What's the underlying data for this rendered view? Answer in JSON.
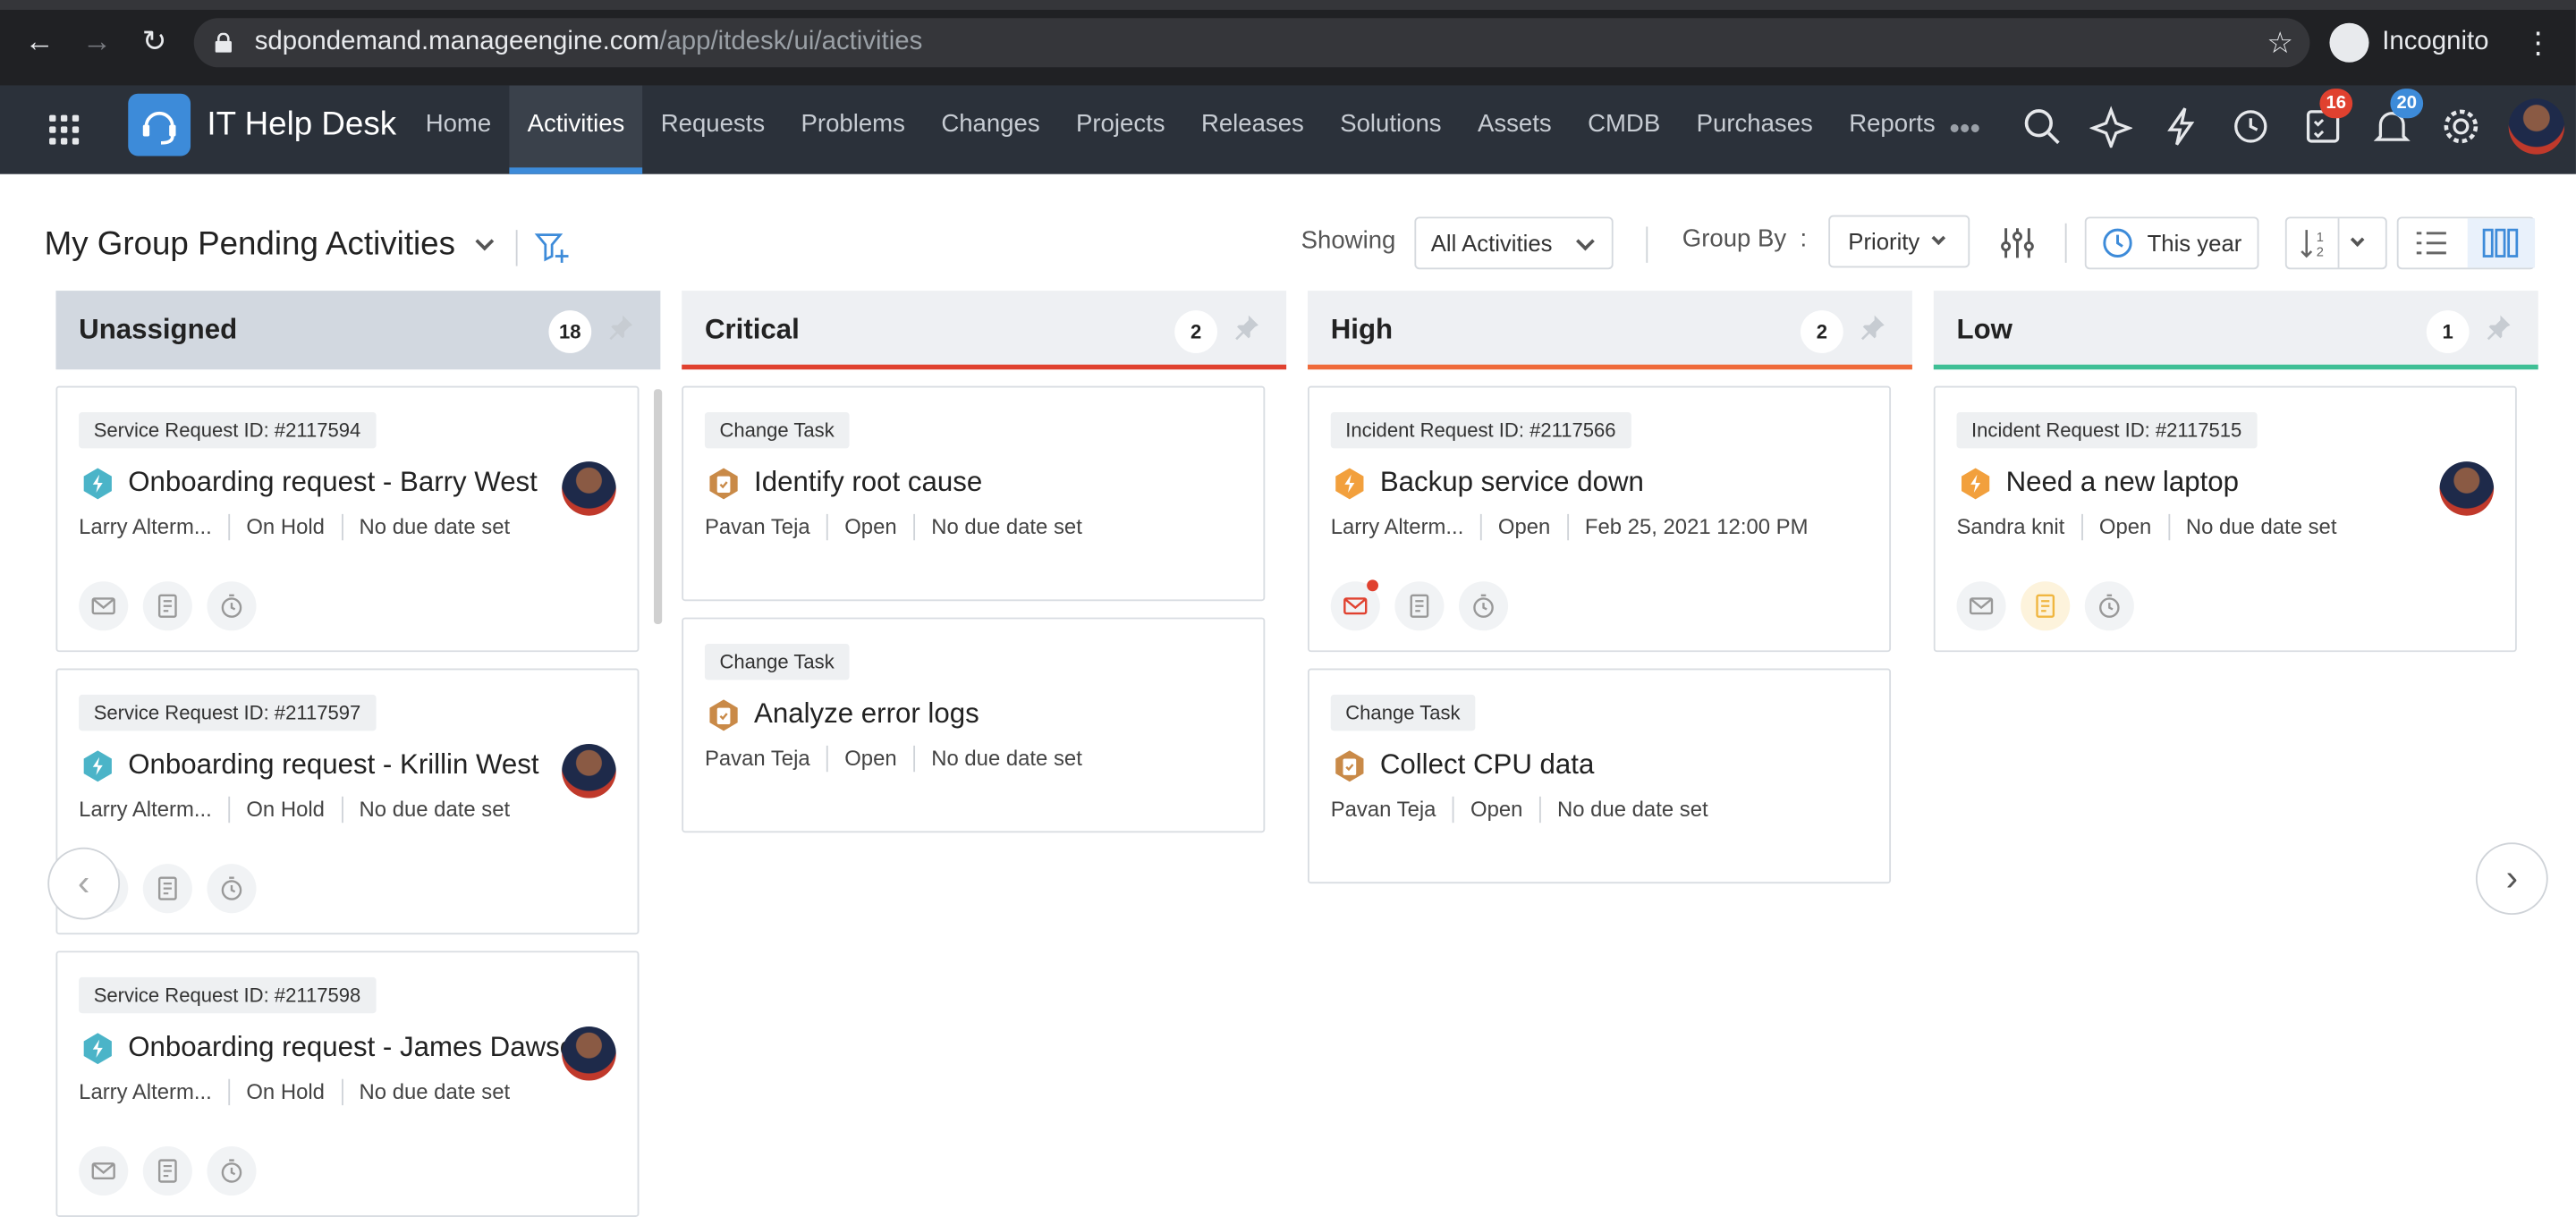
{
  "browser": {
    "url_host": "sdpondemand.manageengine.com",
    "url_path": "/app/itdesk/ui/activities",
    "mode": "Incognito"
  },
  "app": {
    "title": "IT Help Desk",
    "nav_tabs": [
      "Home",
      "Activities",
      "Requests",
      "Problems",
      "Changes",
      "Projects",
      "Releases",
      "Solutions",
      "Assets",
      "CMDB",
      "Purchases",
      "Reports"
    ],
    "active_tab": "Activities",
    "task_badge": "16",
    "notif_badge": "20"
  },
  "header": {
    "title": "My Group Pending Activities",
    "showing_label": "Showing",
    "showing_value": "All Activities",
    "group_by_label": "Group By",
    "group_by_value": "Priority",
    "date_filter": "This year"
  },
  "columns": [
    {
      "name": "Unassigned",
      "count": "18",
      "accent": "#d2d8e0",
      "cards": [
        {
          "tag": "Service Request ID: #2117594",
          "title": "Onboarding request - Barry West",
          "owner": "Larry Alterm...",
          "status": "On Hold",
          "due": "No due date set"
        },
        {
          "tag": "Service Request ID: #2117597",
          "title": "Onboarding request - Krillin West",
          "owner": "Larry Alterm...",
          "status": "On Hold",
          "due": "No due date set"
        },
        {
          "tag": "Service Request ID: #2117598",
          "title": "Onboarding request - James Dawson",
          "owner": "Larry Alterm...",
          "status": "On Hold",
          "due": "No due date set"
        }
      ]
    },
    {
      "name": "Critical",
      "count": "2",
      "accent": "#e0412f",
      "cards": [
        {
          "tag": "Change Task",
          "title": "Identify root cause",
          "owner": "Pavan Teja",
          "status": "Open",
          "due": "No due date set"
        },
        {
          "tag": "Change Task",
          "title": "Analyze error logs",
          "owner": "Pavan Teja",
          "status": "Open",
          "due": "No due date set"
        }
      ]
    },
    {
      "name": "High",
      "count": "2",
      "accent": "#ef6a3a",
      "cards": [
        {
          "tag": "Incident Request ID: #2117566",
          "title": "Backup service down",
          "owner": "Larry Alterm...",
          "status": "Open",
          "due": "Feb 25, 2021 12:00 PM"
        },
        {
          "tag": "Change Task",
          "title": "Collect CPU data",
          "owner": "Pavan Teja",
          "status": "Open",
          "due": "No due date set"
        }
      ]
    },
    {
      "name": "Low",
      "count": "1",
      "accent": "#3fbf95",
      "cards": [
        {
          "tag": "Incident Request ID: #2117515",
          "title": "Need a new laptop",
          "owner": "Sandra knit",
          "status": "Open",
          "due": "No due date set"
        }
      ]
    }
  ]
}
